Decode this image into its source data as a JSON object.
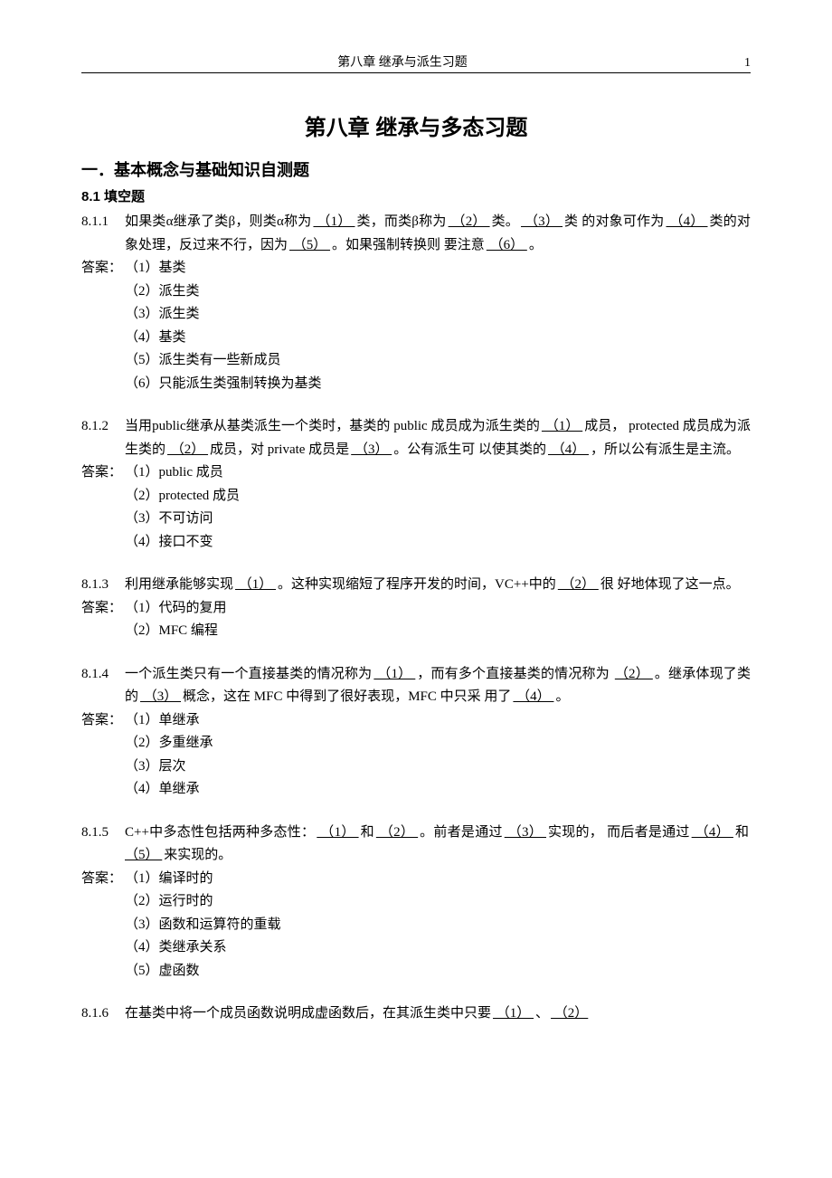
{
  "header": {
    "title": "第八章  继承与派生习题",
    "page_number": "1"
  },
  "title": "第八章    继承与多态习题",
  "section1": "一．基本概念与基础知识自测题",
  "subsection": "8.1    填空题",
  "q1": {
    "num": "8.1.1",
    "line1_a": "如果类α继承了类β，则类α称为",
    "b1": "  （1） ",
    "line1_b": "类，而类β称为",
    "b2": "  （2）  ",
    "line1_c": "类。",
    "b3": "  （3）  ",
    "line1_d": "类",
    "line2_a": "的对象可作为",
    "b4": "  （4） ",
    "line2_b": "类的对象处理，反过来不行，因为",
    "b5": "  （5）  ",
    "line2_c": "。如果强制转换则",
    "line3_a": "要注意",
    "b6": "   （6）   ",
    "line3_b": "。",
    "ans_label": "答案：",
    "answers": [
      "（1）基类",
      "（2）派生类",
      "（3）派生类",
      "（4）基类",
      "（5）派生类有一些新成员",
      "（6）只能派生类强制转换为基类"
    ]
  },
  "q2": {
    "num": "8.1.2",
    "line1_a": "当用public继承从基类派生一个类时，基类的 public 成员成为派生类的",
    "b1": "   （1） ",
    "line1_b": "成员，",
    "line2_a": "protected 成员成为派生类的",
    "b2": "   （2）   ",
    "line2_b": "成员，对 private 成员是",
    "b3": "  （3）  ",
    "line2_c": "。公有派生可",
    "line3_a": "以使其类的",
    "b4": "   （4）   ",
    "line3_b": "，所以公有派生是主流。",
    "ans_label": "答案：",
    "answers": [
      "（1）public 成员",
      "（2）protected 成员",
      "（3）不可访问",
      "（4）接口不变"
    ]
  },
  "q3": {
    "num": "8.1.3",
    "line1_a": "利用继承能够实现",
    "b1": "  （1）  ",
    "line1_b": "。这种实现缩短了程序开发的时间，VC++中的",
    "b2": "  （2） ",
    "line1_c": "很",
    "line2_a": "好地体现了这一点。",
    "ans_label": "答案：",
    "answers": [
      "（1）代码的复用",
      "（2）MFC 编程"
    ]
  },
  "q4": {
    "num": "8.1.4",
    "line1_a": "一个派生类只有一个直接基类的情况称为",
    "b1": "   （1）   ",
    "line1_b": "，而有多个直接基类的情况称为",
    "b2": "  （2）   ",
    "line2_a": "。继承体现了类的",
    "b3": "   （3） ",
    "line2_b": "概念，这在 MFC 中得到了很好表现，MFC 中只采",
    "line3_a": "用了",
    "b4": "  （4）  ",
    "line3_b": "。",
    "ans_label": "答案：",
    "answers": [
      "（1）单继承",
      "（2）多重继承",
      "（3）层次",
      "（4）单继承"
    ]
  },
  "q5": {
    "num": "8.1.5",
    "line1_a": "C++中多态性包括两种多态性：",
    "b1": "   （1）   ",
    "line1_b": "和",
    "b2": "   （2）   ",
    "line1_c": "。前者是通过",
    "b3": "  （3） ",
    "line1_d": "实现的，",
    "line2_a": "而后者是通过",
    "b4": "   （4） ",
    "line2_b": "和",
    "b5": "   （5）   ",
    "line2_c": "来实现的。",
    "ans_label": "答案：",
    "answers": [
      "（1）编译时的",
      "（2）运行时的",
      "（3）函数和运算符的重载",
      "（4）类继承关系",
      "（5）虚函数"
    ]
  },
  "q6": {
    "num": "8.1.6",
    "line1_a": "在基类中将一个成员函数说明成虚函数后，在其派生类中只要",
    "b1": "   （1）   ",
    "line1_b": "、",
    "b2": "  （2）  "
  }
}
